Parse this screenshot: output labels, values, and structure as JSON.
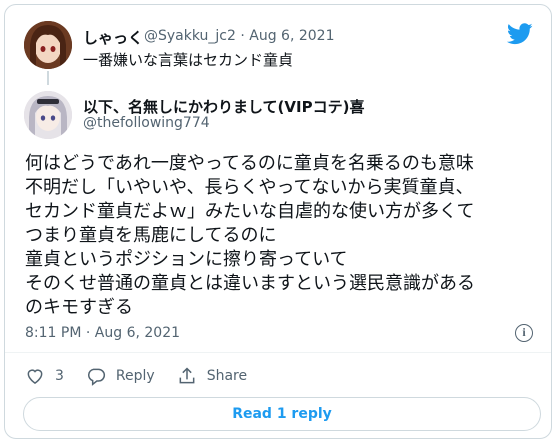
{
  "quoted_tweet": {
    "display_name": "しゃっく",
    "handle": "@Syakku_jc2",
    "separator": "·",
    "date": "Aug 6, 2021",
    "text": "一番嫌いな言葉はセカンド童貞"
  },
  "reply_tweet": {
    "display_name": "以下、名無しにかわりまして(VIPコテ)喜",
    "handle": "@thefollowing774",
    "body": "何はどうであれ一度やってるのに童貞を名乗るのも意味\n不明だし「いやいや、長らくやってないから実質童貞、\nセカンド童貞だよｗ」みたいな自虐的な使い方が多くて\nつまり童貞を馬鹿にしてるのに\n童貞というポジションに擦り寄っていて\nそのくせ普通の童貞とは違いますという選民意識がある\nのキモすぎる",
    "time": "8:11 PM",
    "date": "Aug 6, 2021"
  },
  "actions": {
    "like_count": "3",
    "reply_label": "Reply",
    "share_label": "Share"
  },
  "read_replies_label": "Read 1 reply",
  "colors": {
    "accent": "#1d9bf0",
    "muted": "#536471",
    "border": "#cfd9de"
  },
  "icons": [
    "twitter-bird-icon",
    "info-icon",
    "heart-icon",
    "reply-icon",
    "share-icon"
  ]
}
